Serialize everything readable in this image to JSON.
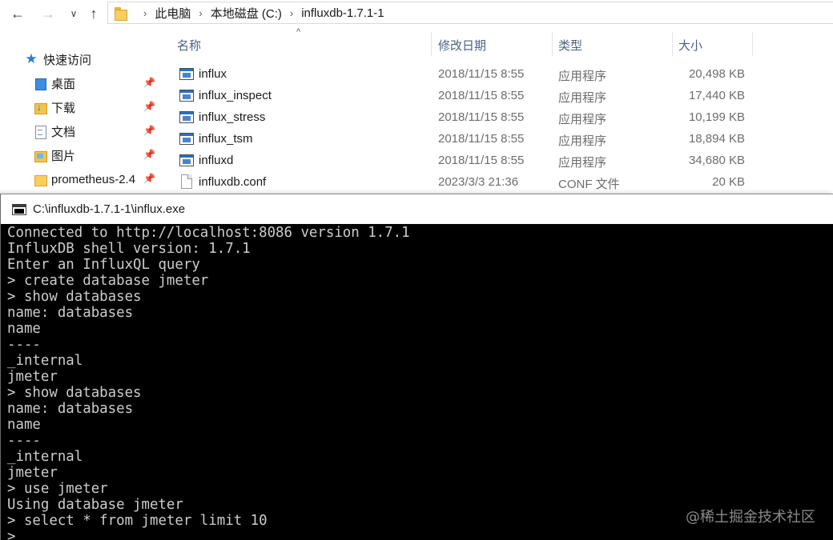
{
  "explorer": {
    "nav": {
      "back": "←",
      "forward": "→",
      "recent": "∨",
      "up": "↑"
    },
    "breadcrumb": [
      "此电脑",
      "本地磁盘 (C:)",
      "influxdb-1.7.1-1"
    ],
    "breadcrumb_sep": "›",
    "sort_caret": "^",
    "quick_access": {
      "title": "快速访问",
      "items": [
        {
          "label": "桌面",
          "icon": "desktop-folder-icon",
          "pinned": true
        },
        {
          "label": "下载",
          "icon": "downloads-folder-icon",
          "pinned": true
        },
        {
          "label": "文档",
          "icon": "documents-folder-icon",
          "pinned": true
        },
        {
          "label": "图片",
          "icon": "pictures-folder-icon",
          "pinned": true
        },
        {
          "label": "prometheus-2.4",
          "icon": "folder-icon",
          "pinned": true
        }
      ],
      "pin_glyph": "📌"
    },
    "columns": {
      "name": "名称",
      "date": "修改日期",
      "type": "类型",
      "size": "大小"
    },
    "files": [
      {
        "name": "influx",
        "date": "2018/11/15 8:55",
        "type": "应用程序",
        "size": "20,498 KB",
        "icon": "exe-icon"
      },
      {
        "name": "influx_inspect",
        "date": "2018/11/15 8:55",
        "type": "应用程序",
        "size": "17,440 KB",
        "icon": "exe-icon"
      },
      {
        "name": "influx_stress",
        "date": "2018/11/15 8:55",
        "type": "应用程序",
        "size": "10,199 KB",
        "icon": "exe-icon"
      },
      {
        "name": "influx_tsm",
        "date": "2018/11/15 8:55",
        "type": "应用程序",
        "size": "18,894 KB",
        "icon": "exe-icon"
      },
      {
        "name": "influxd",
        "date": "2018/11/15 8:55",
        "type": "应用程序",
        "size": "34,680 KB",
        "icon": "exe-icon"
      },
      {
        "name": "influxdb.conf",
        "date": "2023/3/3 21:36",
        "type": "CONF 文件",
        "size": "20 KB",
        "icon": "file-icon"
      }
    ]
  },
  "console": {
    "title": "C:\\influxdb-1.7.1-1\\influx.exe",
    "lines": [
      "Connected to http://localhost:8086 version 1.7.1",
      "InfluxDB shell version: 1.7.1",
      "Enter an InfluxQL query",
      "> create database jmeter",
      "> show databases",
      "name: databases",
      "name",
      "----",
      "_internal",
      "jmeter",
      "> show databases",
      "name: databases",
      "name",
      "----",
      "_internal",
      "jmeter",
      "> use jmeter",
      "Using database jmeter",
      "> select * from jmeter limit 10",
      ">"
    ]
  },
  "watermark": "@稀土掘金技术社区"
}
